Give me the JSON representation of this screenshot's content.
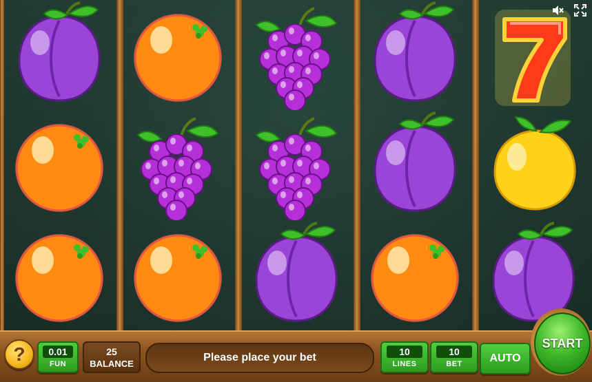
{
  "controls": {
    "help_label": "?",
    "coin": {
      "value": "0.01",
      "label": "FUN"
    },
    "balance": {
      "value": "25",
      "label": "BALANCE"
    },
    "message": "Please place your bet",
    "lines": {
      "value": "10",
      "label": "LINES"
    },
    "bet": {
      "value": "10",
      "label": "BET"
    },
    "auto_label": "AUTO",
    "start_label": "START"
  },
  "top_icons": [
    "sound-muted-icon",
    "fullscreen-icon"
  ],
  "reels": [
    [
      "plum",
      "orange",
      "orange"
    ],
    [
      "orange",
      "grapes",
      "orange"
    ],
    [
      "grapes",
      "grapes",
      "plum"
    ],
    [
      "plum",
      "plum",
      "orange"
    ],
    [
      "seven",
      "lemon",
      "plum"
    ]
  ],
  "colors": {
    "button_green": "#3fb82a",
    "frame_wood": "#b27434",
    "plum": "#9b45d8",
    "orange": "#ff8a12",
    "grapes": "#b530d8",
    "lemon": "#ffd21a",
    "seven": "#ff3a1a"
  }
}
